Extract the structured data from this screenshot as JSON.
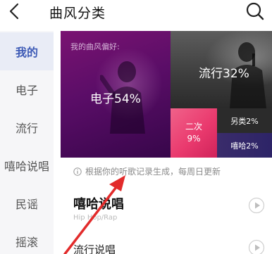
{
  "header": {
    "back_icon": "back-chevron-icon",
    "title": "曲风分类",
    "search_icon": "search-icon"
  },
  "sidebar": {
    "items": [
      {
        "label": "我的",
        "active": true
      },
      {
        "label": "电子"
      },
      {
        "label": "流行"
      },
      {
        "label": "嘻哈说唱"
      },
      {
        "label": "民谣"
      },
      {
        "label": "摇滚"
      }
    ]
  },
  "preference": {
    "label": "我的曲风偏好:",
    "tiles": {
      "electronic": "电子54%",
      "pop": "流行32%",
      "anime_name": "二次",
      "anime_pct": "9%",
      "other": "另类2%",
      "hiphop": "嘻哈2%"
    },
    "values": {
      "electronic": 54,
      "pop": 32,
      "anime": 9,
      "other": 2,
      "hiphop": 2
    }
  },
  "hint": "根据你的听歌记录生成，每周日更新",
  "sections": [
    {
      "title": "嘻哈说唱",
      "subtitle": "Hip Hop/Rap"
    },
    {
      "title": "流行说唱"
    }
  ],
  "colors": {
    "accent": "#3e5bb6",
    "electronic_tile": "#6a0f6e",
    "anime_tile": "#ea3a6e",
    "hiphop_tile": "#2d2467",
    "annotation_arrow": "#e22b2b"
  }
}
